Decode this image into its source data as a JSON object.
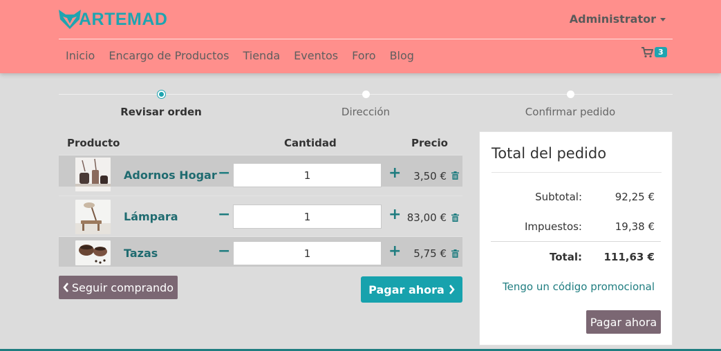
{
  "brand": {
    "name": "ARTEMAD",
    "color": "#1fa4b0"
  },
  "header": {
    "user": "Administrator",
    "nav": [
      "Inicio",
      "Encargo de Productos",
      "Tienda",
      "Eventos",
      "Foro",
      "Blog"
    ],
    "cart_count": "3",
    "cart_icon": "cart-icon"
  },
  "steps": [
    {
      "label": "Revisar orden",
      "active": true
    },
    {
      "label": "Dirección",
      "active": false
    },
    {
      "label": "Confirmar pedido",
      "active": false
    }
  ],
  "table": {
    "headers": {
      "product": "Producto",
      "quantity": "Cantidad",
      "price": "Precio"
    },
    "rows": [
      {
        "name": "Adornos Hogar",
        "qty": "1",
        "price": "3,50 €"
      },
      {
        "name": "Lámpara",
        "qty": "1",
        "price": "83,00 €"
      },
      {
        "name": "Tazas",
        "qty": "1",
        "price": "5,75 €"
      }
    ]
  },
  "actions": {
    "continue": "Seguir comprando",
    "pay": "Pagar ahora"
  },
  "summary": {
    "title": "Total del pedido",
    "subtotal_label": "Subtotal:",
    "subtotal": "92,25 €",
    "tax_label": "Impuestos:",
    "tax": "19,38 €",
    "total_label": "Total:",
    "total": "111,63 €",
    "promo": "Tengo un código promocional",
    "pay": "Pagar ahora"
  },
  "colors": {
    "header": "#ff8f8c",
    "accent": "#1fa4b0",
    "secondary_button": "#7b6773",
    "background": "#dcdcdc"
  }
}
